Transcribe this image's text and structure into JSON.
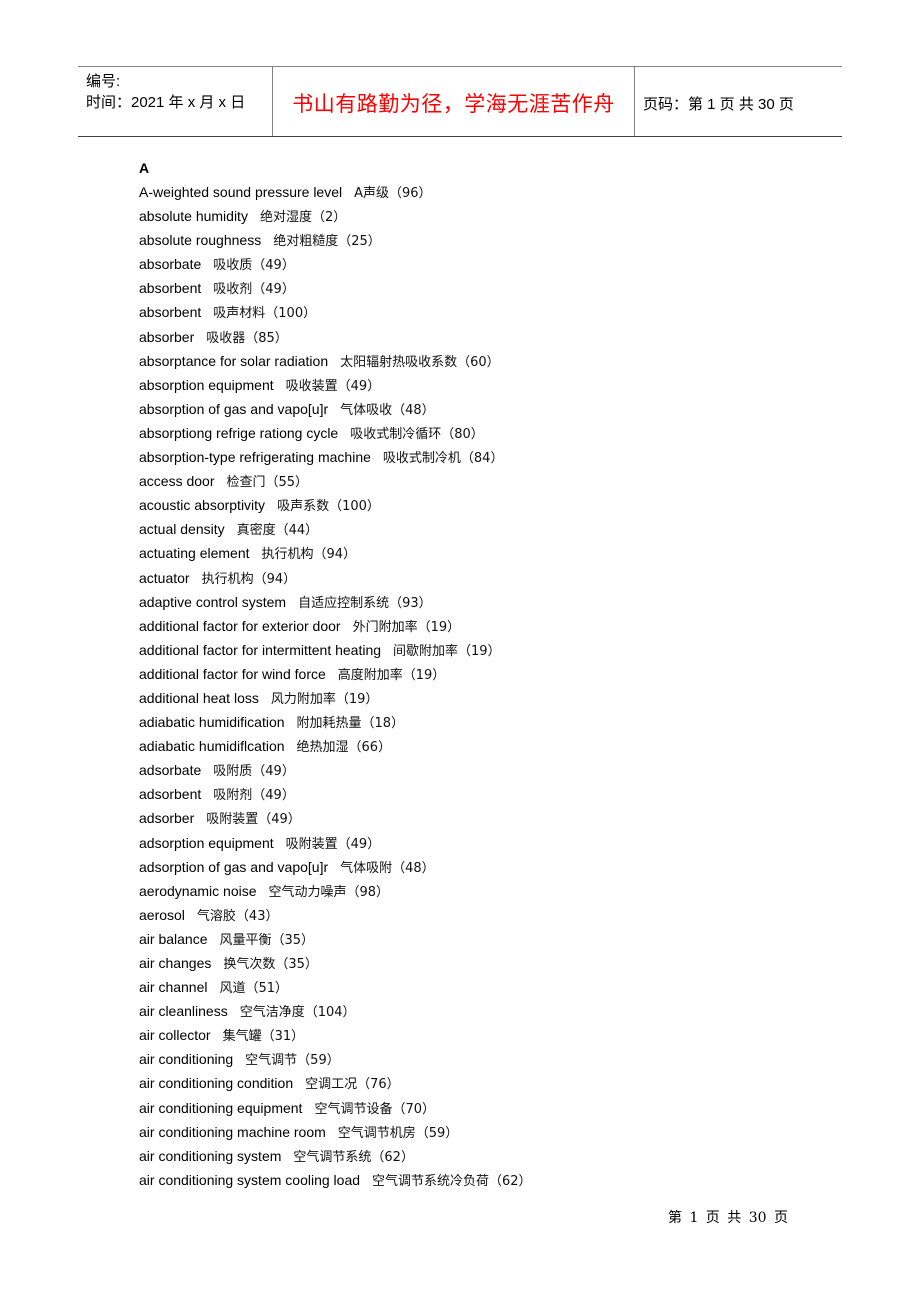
{
  "header": {
    "serial_label": "编号:",
    "date_label": "时间：2021 年 x 月 x 日",
    "motto": "书山有路勤为径，学海无涯苦作舟",
    "page_info": "页码：第 1 页  共 30 页"
  },
  "section_letter": "A",
  "entries": [
    {
      "en": "A-weighted sound pressure level",
      "zh": "A声级（96）"
    },
    {
      "en": "absolute humidity",
      "zh": "绝对湿度（2）"
    },
    {
      "en": "absolute roughness",
      "zh": "绝对粗糙度（25）"
    },
    {
      "en": "absorbate",
      "zh": "吸收质（49）"
    },
    {
      "en": "absorbent",
      "zh": "吸收剂（49）"
    },
    {
      "en": "absorbent",
      "zh": "吸声材料（100）"
    },
    {
      "en": "absorber",
      "zh": "吸收器（85）"
    },
    {
      "en": "absorptance for solar radiation",
      "zh": "太阳辐射热吸收系数（60）"
    },
    {
      "en": "absorption equipment",
      "zh": "吸收装置（49）"
    },
    {
      "en": "absorption of gas and vapo[u]r",
      "zh": "气体吸收（48）"
    },
    {
      "en": "absorptiong refrige rationg cycle",
      "zh": "吸收式制冷循环（80）"
    },
    {
      "en": "absorption-type refrigerating machine",
      "zh": "吸收式制冷机（84）"
    },
    {
      "en": "access door",
      "zh": "检查门（55）"
    },
    {
      "en": "acoustic absorptivity",
      "zh": "吸声系数（100）"
    },
    {
      "en": "actual density",
      "zh": "真密度（44）"
    },
    {
      "en": "actuating element",
      "zh": "执行机构（94）"
    },
    {
      "en": "actuator",
      "zh": "执行机构（94）"
    },
    {
      "en": "adaptive control system",
      "zh": "自适应控制系统（93）"
    },
    {
      "en": "additional factor for exterior door",
      "zh": "外门附加率（19）"
    },
    {
      "en": "additional factor for intermittent heating",
      "zh": "间歇附加率（19）"
    },
    {
      "en": "additional factor for wind force",
      "zh": "高度附加率（19）"
    },
    {
      "en": "additional heat loss",
      "zh": "风力附加率（19）"
    },
    {
      "en": "adiabatic humidification",
      "zh": "附加耗热量（18）"
    },
    {
      "en": "adiabatic humidiflcation",
      "zh": "绝热加湿（66）"
    },
    {
      "en": "adsorbate",
      "zh": "吸附质（49）"
    },
    {
      "en": "adsorbent",
      "zh": "吸附剂（49）"
    },
    {
      "en": "adsorber",
      "zh": "吸附装置（49）"
    },
    {
      "en": "adsorption equipment",
      "zh": "吸附装置（49）"
    },
    {
      "en": "adsorption of gas and vapo[u]r",
      "zh": "气体吸附（48）"
    },
    {
      "en": "aerodynamic noise",
      "zh": "空气动力噪声（98）"
    },
    {
      "en": "aerosol",
      "zh": "气溶胶（43）"
    },
    {
      "en": "air balance",
      "zh": "风量平衡（35）"
    },
    {
      "en": "air changes",
      "zh": "换气次数（35）"
    },
    {
      "en": "air channel",
      "zh": "风道（51）"
    },
    {
      "en": "air cleanliness",
      "zh": "空气洁净度（104）"
    },
    {
      "en": "air collector",
      "zh": "集气罐（31）"
    },
    {
      "en": "air conditioning",
      "zh": "空气调节（59）"
    },
    {
      "en": "air conditioning condition",
      "zh": "空调工况（76）"
    },
    {
      "en": "air conditioning equipment",
      "zh": "空气调节设备（70）"
    },
    {
      "en": "air conditioning machine room",
      "zh": "空气调节机房（59）"
    },
    {
      "en": "air conditioning system",
      "zh": "空气调节系统（62）"
    },
    {
      "en": "air conditioning system cooling load",
      "zh": "空气调节系统冷负荷（62）"
    }
  ],
  "footer": {
    "page_label": "第 1 页 共 30 页"
  }
}
